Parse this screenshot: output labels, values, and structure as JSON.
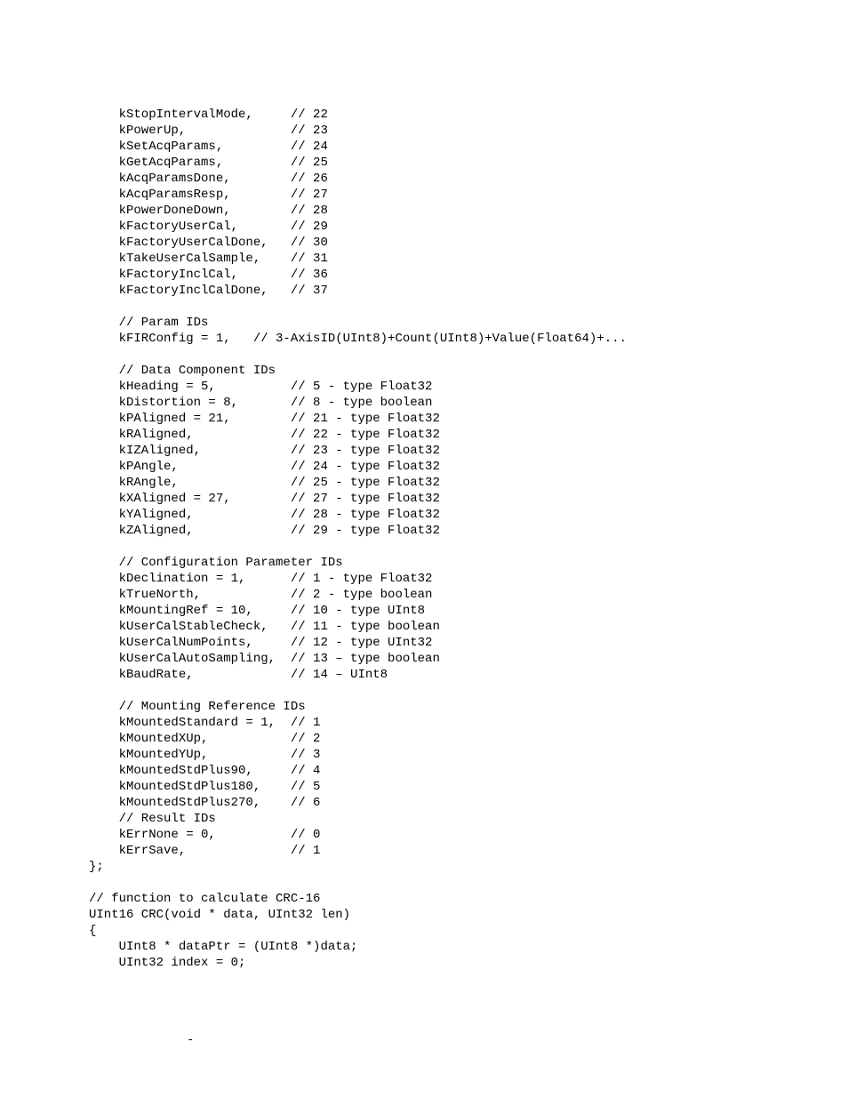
{
  "code_lines": [
    "    kStopIntervalMode,     // 22",
    "    kPowerUp,              // 23",
    "    kSetAcqParams,         // 24",
    "    kGetAcqParams,         // 25",
    "    kAcqParamsDone,        // 26",
    "    kAcqParamsResp,        // 27",
    "    kPowerDoneDown,        // 28",
    "    kFactoryUserCal,       // 29",
    "    kFactoryUserCalDone,   // 30",
    "    kTakeUserCalSample,    // 31",
    "    kFactoryInclCal,       // 36",
    "    kFactoryInclCalDone,   // 37",
    "",
    "    // Param IDs",
    "    kFIRConfig = 1,   // 3-AxisID(UInt8)+Count(UInt8)+Value(Float64)+...",
    "",
    "    // Data Component IDs",
    "    kHeading = 5,          // 5 - type Float32",
    "    kDistortion = 8,       // 8 - type boolean",
    "    kPAligned = 21,        // 21 - type Float32",
    "    kRAligned,             // 22 - type Float32",
    "    kIZAligned,            // 23 - type Float32",
    "    kPAngle,               // 24 - type Float32",
    "    kRAngle,               // 25 - type Float32",
    "    kXAligned = 27,        // 27 - type Float32",
    "    kYAligned,             // 28 - type Float32",
    "    kZAligned,             // 29 - type Float32",
    "",
    "    // Configuration Parameter IDs",
    "    kDeclination = 1,      // 1 - type Float32",
    "    kTrueNorth,            // 2 - type boolean",
    "    kMountingRef = 10,     // 10 - type UInt8",
    "    kUserCalStableCheck,   // 11 - type boolean",
    "    kUserCalNumPoints,     // 12 - type UInt32",
    "    kUserCalAutoSampling,  // 13 – type boolean",
    "    kBaudRate,             // 14 – UInt8",
    "",
    "    // Mounting Reference IDs",
    "    kMountedStandard = 1,  // 1",
    "    kMountedXUp,           // 2",
    "    kMountedYUp,           // 3",
    "    kMountedStdPlus90,     // 4",
    "    kMountedStdPlus180,    // 5",
    "    kMountedStdPlus270,    // 6",
    "    // Result IDs",
    "    kErrNone = 0,          // 0",
    "    kErrSave,              // 1",
    "};",
    "",
    "// function to calculate CRC-16",
    "UInt16 CRC(void * data, UInt32 len)",
    "{",
    "    UInt8 * dataPtr = (UInt8 *)data;",
    "    UInt32 index = 0;"
  ],
  "footer": "-"
}
